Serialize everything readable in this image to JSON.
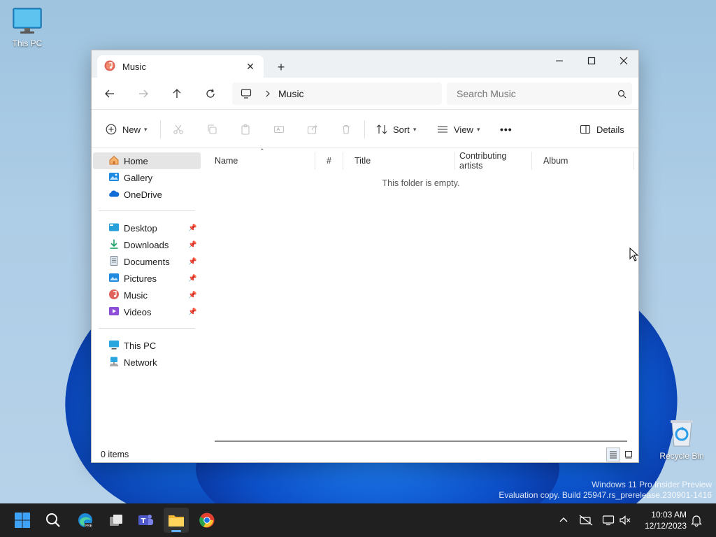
{
  "desktop": {
    "icons": [
      {
        "label": "This PC"
      },
      {
        "label": "Recycle Bin"
      }
    ],
    "watermark": {
      "line1": "Windows 11 Pro Insider Preview",
      "line2": "Evaluation copy. Build 25947.rs_prerelease.230901-1416"
    }
  },
  "window": {
    "tab_title": "Music",
    "new_tab_label": "+",
    "address": {
      "crumb": "Music"
    },
    "search": {
      "placeholder": "Search Music"
    },
    "commands": {
      "new_label": "New",
      "sort_label": "Sort",
      "view_label": "View",
      "more_label": "•••",
      "details_label": "Details"
    },
    "nav": {
      "group1": [
        {
          "label": "Home",
          "selected": true
        },
        {
          "label": "Gallery"
        },
        {
          "label": "OneDrive"
        }
      ],
      "quick_access": [
        {
          "label": "Desktop"
        },
        {
          "label": "Downloads"
        },
        {
          "label": "Documents"
        },
        {
          "label": "Pictures"
        },
        {
          "label": "Music"
        },
        {
          "label": "Videos"
        }
      ],
      "group3": [
        {
          "label": "This PC"
        },
        {
          "label": "Network"
        }
      ]
    },
    "columns": [
      "Name",
      "#",
      "Title",
      "Contributing artists",
      "Album"
    ],
    "empty_message": "This folder is empty.",
    "status": {
      "items": "0 items"
    }
  },
  "taskbar": {
    "clock": {
      "time": "10:03 AM",
      "date": "12/12/2023"
    }
  },
  "colors": {
    "accent": "#0067c0",
    "taskbar": "#202020",
    "selected_nav": "#e5e5e5"
  }
}
